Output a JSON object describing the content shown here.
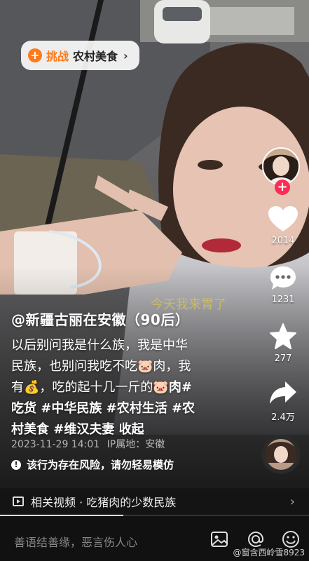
{
  "challenge": {
    "prefix": "挑战",
    "topic": "农村美食"
  },
  "actions": {
    "likes": "2014",
    "comments": "1231",
    "favorites": "277",
    "shares": "2.4万"
  },
  "post": {
    "author": "@新疆古丽在安徽（90后）",
    "line1": "以后别问我是什么族，我是中华",
    "line2a": "民族，也别问我吃不吃",
    "line2b": "肉，我",
    "line3a": "有",
    "line3b": "，吃的起十几一斤的",
    "line3c": "肉#",
    "line4": "吃货 #中华民族 #农村生活 #农",
    "line5": "村美食 #维汉夫妻 收起",
    "date": "2023-11-29 14:01",
    "ip": "IP属地：安徽",
    "warning": "该行为存在风险，请勿轻易模仿"
  },
  "related": {
    "label": "相关视频 · 吃猪肉的少数民族"
  },
  "progress": 0.4,
  "input": {
    "placeholder": "善语结善缘，恶言伤人心"
  },
  "watermark": "@窗含西岭雪8923",
  "colors": {
    "accent": "#fe2c55",
    "challenge": "#ff7a1a"
  }
}
